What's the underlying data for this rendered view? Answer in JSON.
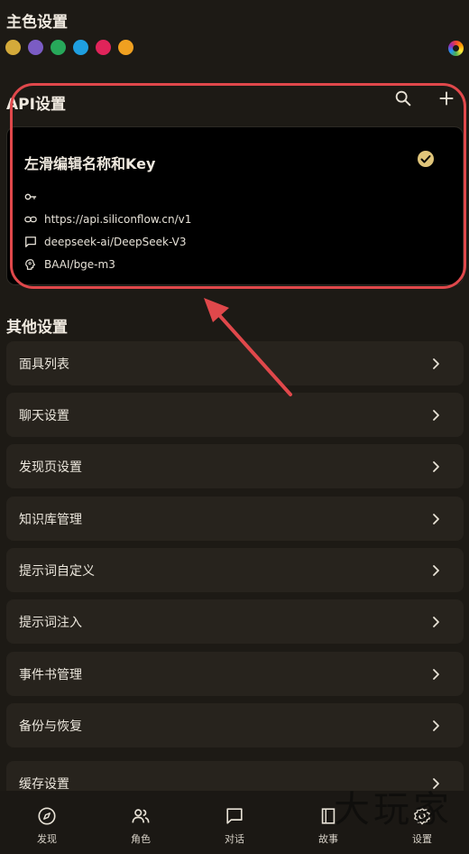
{
  "theme": {
    "title": "主色设置",
    "swatches": [
      "#d4aa3a",
      "#7b5cc4",
      "#27a85a",
      "#1f9fe0",
      "#e0245a",
      "#f0a020"
    ]
  },
  "api": {
    "title": "API设置",
    "card": {
      "title": "左滑编辑名称和Key",
      "key": "",
      "url": "https://api.siliconflow.cn/v1",
      "chat_model": "deepseek-ai/DeepSeek-V3",
      "embedding_model": "BAAI/bge-m3"
    }
  },
  "other": {
    "title": "其他设置",
    "items": [
      {
        "label": "面具列表"
      },
      {
        "label": "聊天设置"
      },
      {
        "label": "发现页设置"
      },
      {
        "label": "知识库管理"
      },
      {
        "label": "提示词自定义"
      },
      {
        "label": "提示词注入"
      },
      {
        "label": "事件书管理"
      },
      {
        "label": "备份与恢复"
      },
      {
        "label": "缓存设置"
      }
    ]
  },
  "nav": [
    {
      "label": "发现",
      "icon": "compass-icon"
    },
    {
      "label": "角色",
      "icon": "users-icon"
    },
    {
      "label": "对话",
      "icon": "chat-icon"
    },
    {
      "label": "故事",
      "icon": "book-icon"
    },
    {
      "label": "设置",
      "icon": "gear-icon"
    }
  ],
  "watermark": "大玩家",
  "colors": {
    "background": "#1d1a15",
    "card": "#27231d",
    "highlight": "#e0484b",
    "accent": "#d4aa3a"
  }
}
